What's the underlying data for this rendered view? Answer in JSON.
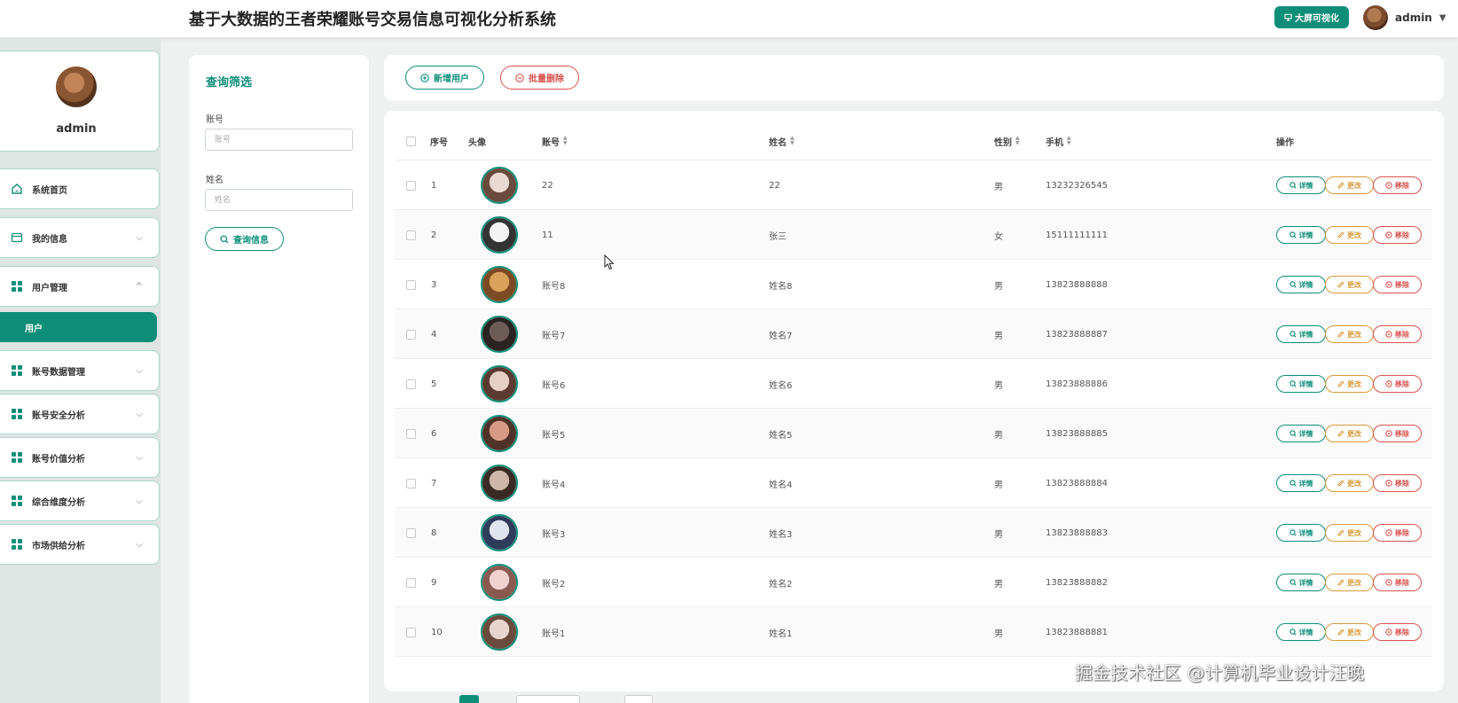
{
  "header": {
    "title": "基于大数据的王者荣耀账号交易信息可视化分析系统",
    "big_screen_label": "大屏可视化",
    "user_name": "admin"
  },
  "sidebar": {
    "profile_name": "admin",
    "items": [
      {
        "label": "系统首页",
        "icon": "home-icon"
      },
      {
        "label": "我的信息",
        "icon": "card-icon"
      },
      {
        "label": "用户管理",
        "icon": "grid-icon"
      },
      {
        "label": "账号数据管理",
        "icon": "grid-icon"
      },
      {
        "label": "账号安全分析",
        "icon": "grid-icon"
      },
      {
        "label": "账号价值分析",
        "icon": "grid-icon"
      },
      {
        "label": "综合维度分析",
        "icon": "grid-icon"
      },
      {
        "label": "市场供给分析",
        "icon": "grid-icon"
      }
    ],
    "active_sub_item": "用户"
  },
  "filter": {
    "title": "查询筛选",
    "account_label": "账号",
    "account_placeholder": "账号",
    "name_label": "姓名",
    "name_placeholder": "姓名",
    "search_button": "查询信息"
  },
  "toolbar": {
    "add_label": "新增用户",
    "batch_delete_label": "批量删除"
  },
  "table": {
    "headers": {
      "index": "序号",
      "avatar": "头像",
      "account": "账号",
      "name": "姓名",
      "gender": "性别",
      "phone": "手机",
      "actions": "操作"
    },
    "actions": {
      "detail": "详情",
      "edit": "更改",
      "remove": "移除"
    },
    "rows": [
      {
        "index": "1",
        "account": "22",
        "name": "22",
        "gender": "男",
        "phone": "13232326545"
      },
      {
        "index": "2",
        "account": "11",
        "name": "张三",
        "gender": "女",
        "phone": "15111111111"
      },
      {
        "index": "3",
        "account": "账号8",
        "name": "姓名8",
        "gender": "男",
        "phone": "13823888888"
      },
      {
        "index": "4",
        "account": "账号7",
        "name": "姓名7",
        "gender": "男",
        "phone": "13823888887"
      },
      {
        "index": "5",
        "account": "账号6",
        "name": "姓名6",
        "gender": "男",
        "phone": "13823888886"
      },
      {
        "index": "6",
        "account": "账号5",
        "name": "姓名5",
        "gender": "男",
        "phone": "13823888885"
      },
      {
        "index": "7",
        "account": "账号4",
        "name": "姓名4",
        "gender": "男",
        "phone": "13823888884"
      },
      {
        "index": "8",
        "account": "账号3",
        "name": "姓名3",
        "gender": "男",
        "phone": "13823888883"
      },
      {
        "index": "9",
        "account": "账号2",
        "name": "姓名2",
        "gender": "男",
        "phone": "13823888882"
      },
      {
        "index": "10",
        "account": "账号1",
        "name": "姓名1",
        "gender": "男",
        "phone": "13823888881"
      }
    ]
  },
  "watermark": "掘金技术社区 @计算机毕业设计汪晚",
  "colors": {
    "primary": "#0e8e78",
    "danger": "#d9534f",
    "warning": "#d89a3a"
  }
}
